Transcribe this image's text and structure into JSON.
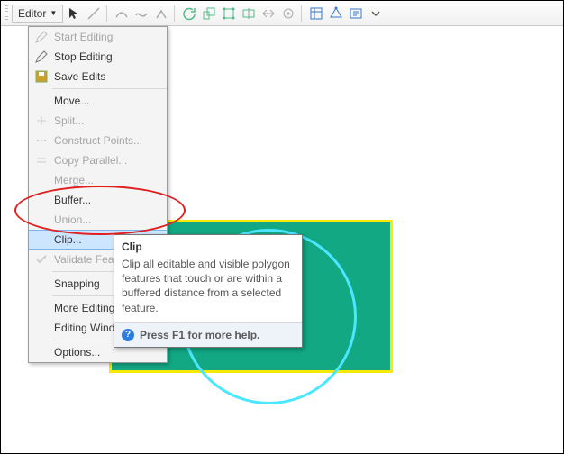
{
  "toolbar": {
    "editor_label": "Editor"
  },
  "menu": {
    "start_editing": "Start Editing",
    "stop_editing": "Stop Editing",
    "save_edits": "Save Edits",
    "move": "Move...",
    "split": "Split...",
    "construct_points": "Construct Points...",
    "copy_parallel": "Copy Parallel...",
    "merge": "Merge...",
    "buffer": "Buffer...",
    "union": "Union...",
    "clip": "Clip...",
    "validate_features": "Validate Features...",
    "snapping": "Snapping",
    "more_editing_tools": "More Editing Tools",
    "editing_windows": "Editing Windows",
    "options": "Options..."
  },
  "tooltip": {
    "title": "Clip",
    "body": "Clip all editable and visible polygon features that touch or are within a buffered distance from a selected feature.",
    "footer": "Press F1 for more help."
  },
  "colors": {
    "rect_fill": "#12a884",
    "rect_border": "#f5ea00",
    "circle": "#4be6ff",
    "highlight": "#cde6ff",
    "annotation": "#e02020"
  }
}
